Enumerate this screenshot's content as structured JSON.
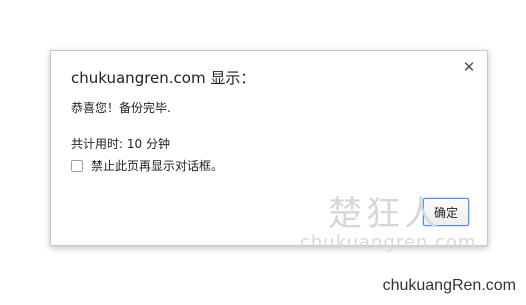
{
  "dialog": {
    "title": "chukuangren.com 显示：",
    "close_icon": "close-icon",
    "close_glyph": "✕",
    "message": "恭喜您！备份完毕.",
    "duration_text": "共计用时: 10 分钟",
    "checkbox_label": "禁止此页再显示对话框。",
    "ok_label": "确定",
    "ok_border_color": "#4d90fe"
  },
  "watermarks": {
    "center_glyphs": "楚狂人",
    "center_text": "chukuangren.com",
    "corner_text": "chukuangRen.com"
  }
}
